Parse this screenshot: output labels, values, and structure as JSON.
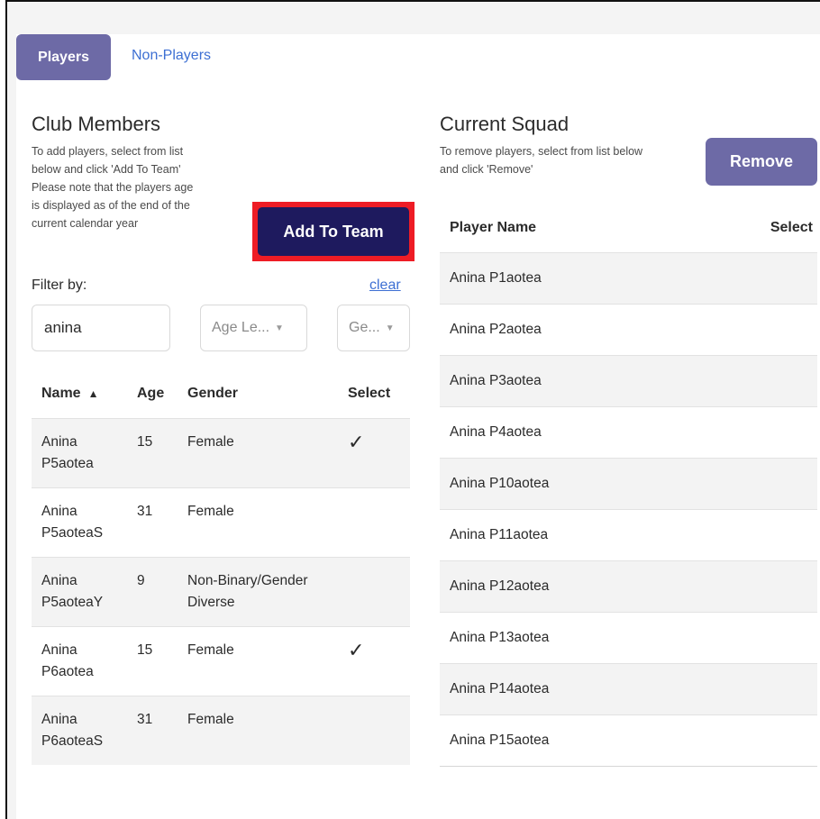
{
  "tabs": {
    "players": "Players",
    "non_players": "Non-Players"
  },
  "club_members": {
    "title": "Club Members",
    "hint": [
      "To add players, select from list",
      "below and click 'Add To Team'",
      "Please note that the players age",
      "is displayed as of the end of the",
      "current calendar year"
    ],
    "add_button": "Add To Team",
    "filter_label": "Filter by:",
    "clear_link": "clear",
    "search_value": "anina",
    "age_level_select": "Age Le...",
    "gender_select": "Ge...",
    "columns": {
      "name": "Name",
      "sort_indicator": "▲",
      "age": "Age",
      "gender": "Gender",
      "select": "Select"
    },
    "rows": [
      {
        "name": "Anina P5aotea",
        "age": "15",
        "gender": "Female",
        "selected": "✓"
      },
      {
        "name": "Anina P5aoteaS",
        "age": "31",
        "gender": "Female",
        "selected": ""
      },
      {
        "name": "Anina P5aoteaY",
        "age": "9",
        "gender": "Non-Binary/Gender Diverse",
        "selected": ""
      },
      {
        "name": "Anina P6aotea",
        "age": "15",
        "gender": "Female",
        "selected": "✓"
      },
      {
        "name": "Anina P6aoteaS",
        "age": "31",
        "gender": "Female",
        "selected": ""
      }
    ]
  },
  "current_squad": {
    "title": "Current Squad",
    "hint": [
      "To remove players, select from list below",
      "and click 'Remove'"
    ],
    "remove_button": "Remove",
    "columns": {
      "player_name": "Player Name",
      "select": "Select"
    },
    "rows": [
      "Anina P1aotea",
      "Anina P2aotea",
      "Anina P3aotea",
      "Anina P4aotea",
      "Anina P10aotea",
      "Anina P11aotea",
      "Anina P12aotea",
      "Anina P13aotea",
      "Anina P14aotea",
      "Anina P15aotea"
    ]
  },
  "colors": {
    "tab_active": "#6d6aa6",
    "add_button": "#1e1a5e",
    "highlight_border": "#ee1c25",
    "link": "#3d6fd3",
    "row_shaded": "#f3f3f3",
    "check": "#2b2f7a"
  },
  "icons": {
    "check": "check-icon",
    "sort": "sort-ascending-icon",
    "dropdown": "caret-down-icon"
  }
}
